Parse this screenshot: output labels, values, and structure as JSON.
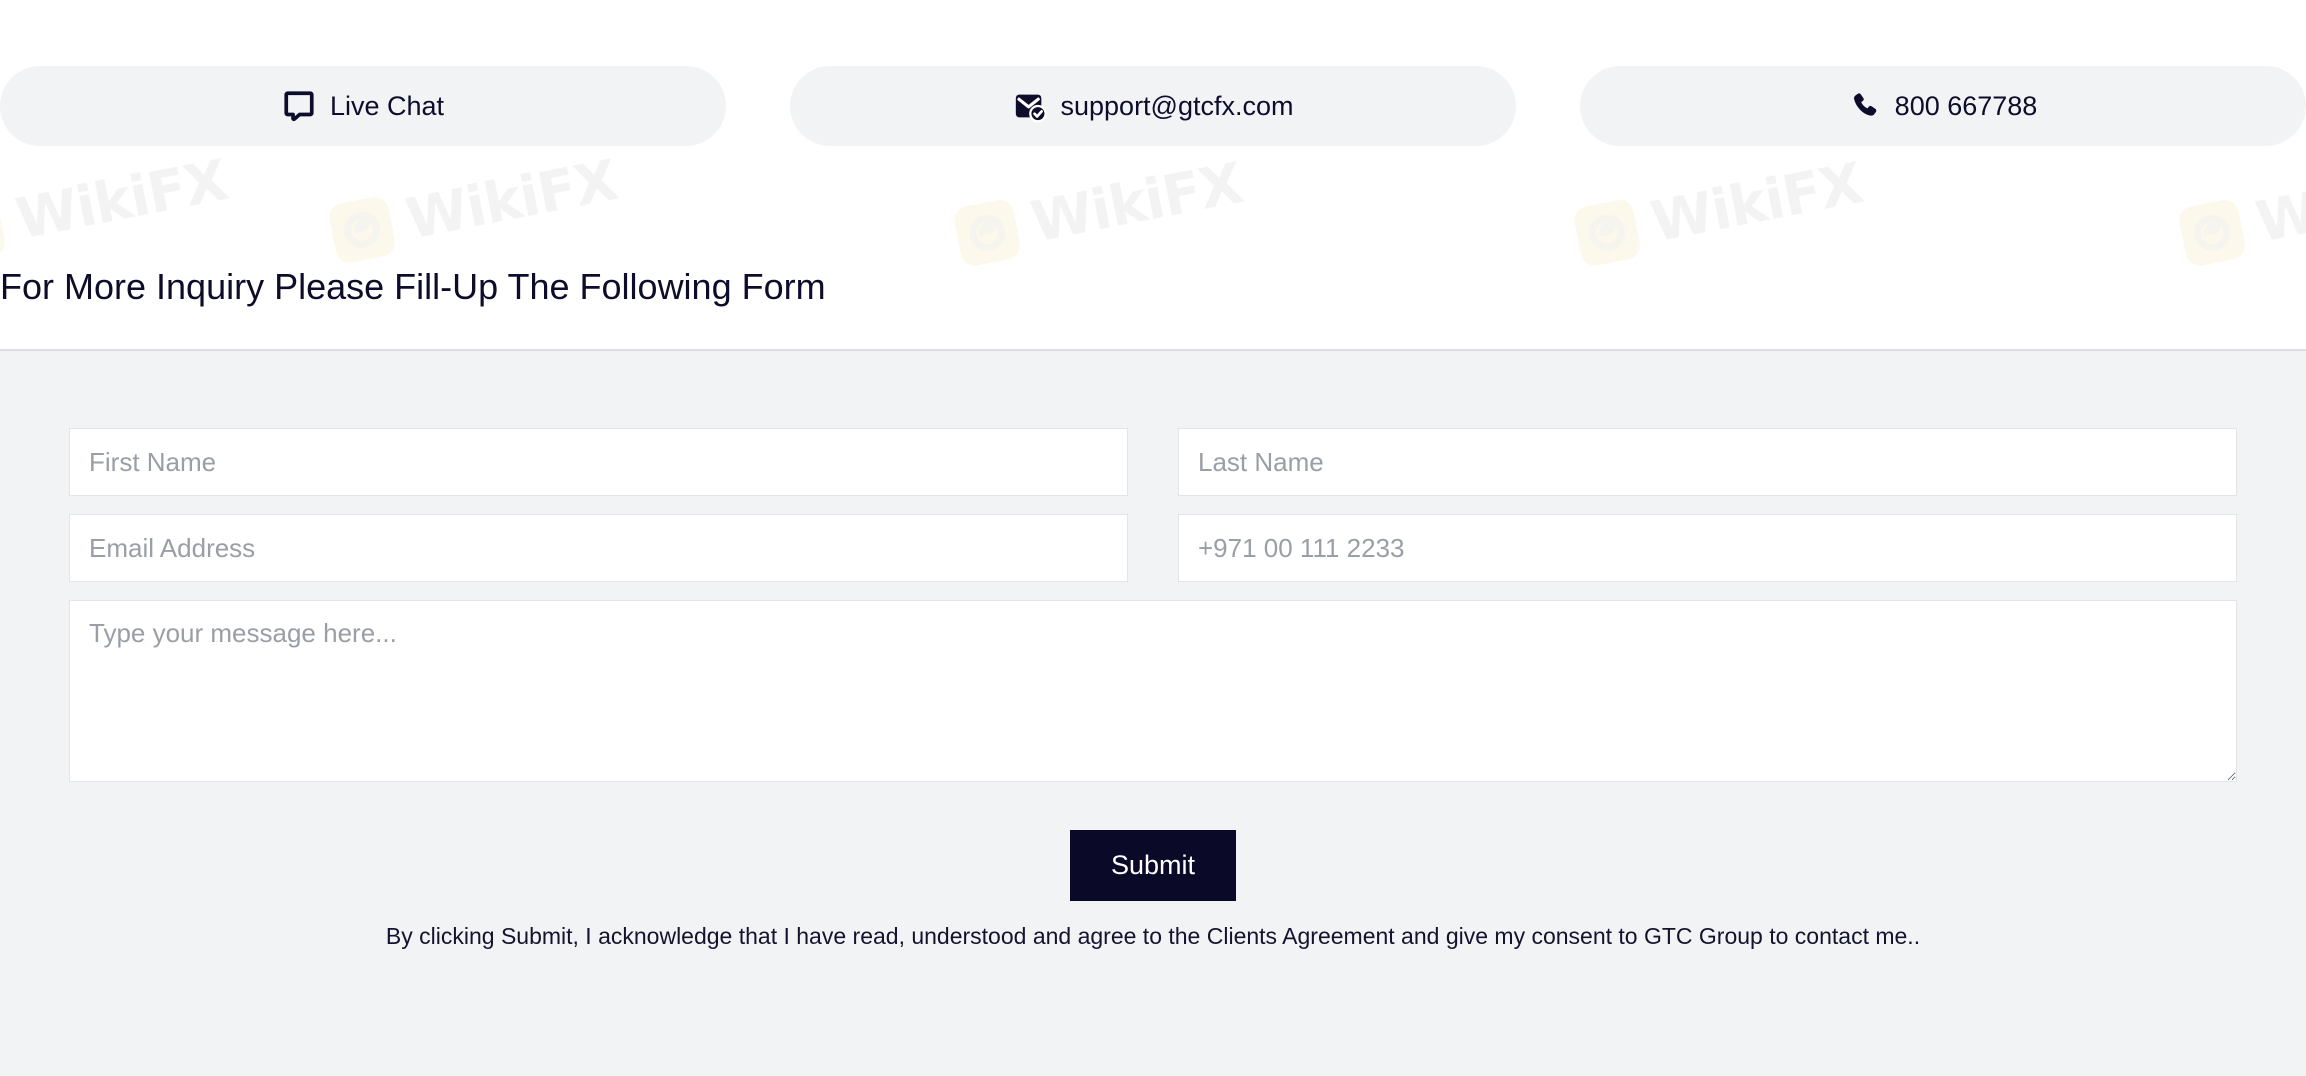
{
  "contact_bar": {
    "items": [
      {
        "icon": "live-chat-icon",
        "label": "Live Chat"
      },
      {
        "icon": "email-verified-icon",
        "label": "support@gtcfx.com"
      },
      {
        "icon": "phone-icon",
        "label": "800 667788"
      }
    ]
  },
  "heading": {
    "title": "For More Inquiry Please Fill-Up The Following Form"
  },
  "form": {
    "first_name": {
      "value": "",
      "placeholder": "First Name"
    },
    "last_name": {
      "value": "",
      "placeholder": "Last Name"
    },
    "email": {
      "value": "",
      "placeholder": "Email Address"
    },
    "phone": {
      "value": "",
      "placeholder": "+971 00 111 2233"
    },
    "message": {
      "value": "",
      "placeholder": "Type your message here..."
    },
    "submit_label": "Submit",
    "disclaimer": "By clicking Submit, I acknowledge that I have read, understood and agree to the Clients Agreement and give my consent to GTC Group to contact me.."
  },
  "watermark": {
    "text": "WikiFX"
  },
  "colors": {
    "pill_background": "#f1f3f5",
    "panel_background": "#f2f3f5",
    "icon_dark": "#0d0d2b",
    "submit_background": "#0a0a28",
    "text_dark": "#0d0d2b",
    "placeholder": "#9a9ea6",
    "field_border": "#e2e4e7",
    "watermark_text": "#e9e9eb",
    "watermark_logo": "#fbf3d8"
  }
}
